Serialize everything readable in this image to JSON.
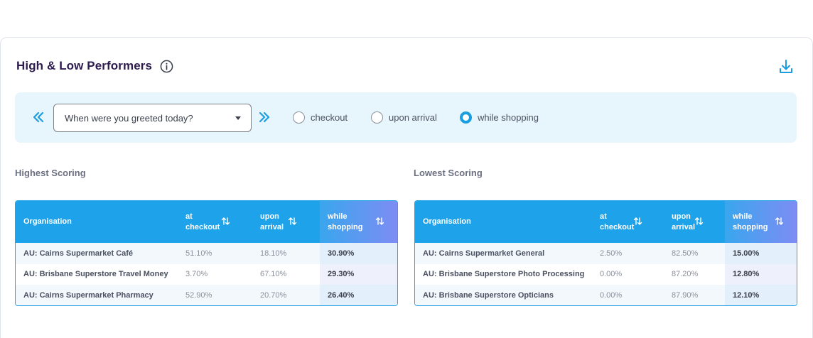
{
  "header": {
    "title": "High & Low Performers"
  },
  "filter": {
    "question": "When were you greeted today?",
    "options": [
      {
        "label": "checkout",
        "selected": false
      },
      {
        "label": "upon arrival",
        "selected": false
      },
      {
        "label": "while shopping",
        "selected": true
      }
    ]
  },
  "highest": {
    "label": "Highest Scoring",
    "columns": {
      "org": "Organisation",
      "c1a": "at",
      "c1b": "checkout",
      "c2a": "upon",
      "c2b": "arrival",
      "c3a": "while",
      "c3b": "shopping"
    },
    "rows": [
      {
        "org": "AU: Cairns Supermarket Café",
        "checkout": "51.10%",
        "arrival": "18.10%",
        "shopping": "30.90%"
      },
      {
        "org": "AU: Brisbane Superstore Travel Money",
        "checkout": "3.70%",
        "arrival": "67.10%",
        "shopping": "29.30%"
      },
      {
        "org": "AU: Cairns Supermarket Pharmacy",
        "checkout": "52.90%",
        "arrival": "20.70%",
        "shopping": "26.40%"
      }
    ]
  },
  "lowest": {
    "label": "Lowest Scoring",
    "columns": {
      "org": "Organisation",
      "c1a": "at",
      "c1b": "checkout",
      "c2a": "upon",
      "c2b": "arrival",
      "c3a": "while",
      "c3b": "shopping"
    },
    "rows": [
      {
        "org": "AU: Cairns Supermarket General",
        "checkout": "2.50%",
        "arrival": "82.50%",
        "shopping": "15.00%"
      },
      {
        "org": "AU: Brisbane Superstore Photo Processing",
        "checkout": "0.00%",
        "arrival": "87.20%",
        "shopping": "12.80%"
      },
      {
        "org": "AU: Brisbane Superstore Opticians",
        "checkout": "0.00%",
        "arrival": "87.90%",
        "shopping": "12.10%"
      }
    ]
  },
  "colors": {
    "accent": "#1ea3ea",
    "title": "#2d1b4e",
    "filter_bg": "#e7f5fd"
  }
}
